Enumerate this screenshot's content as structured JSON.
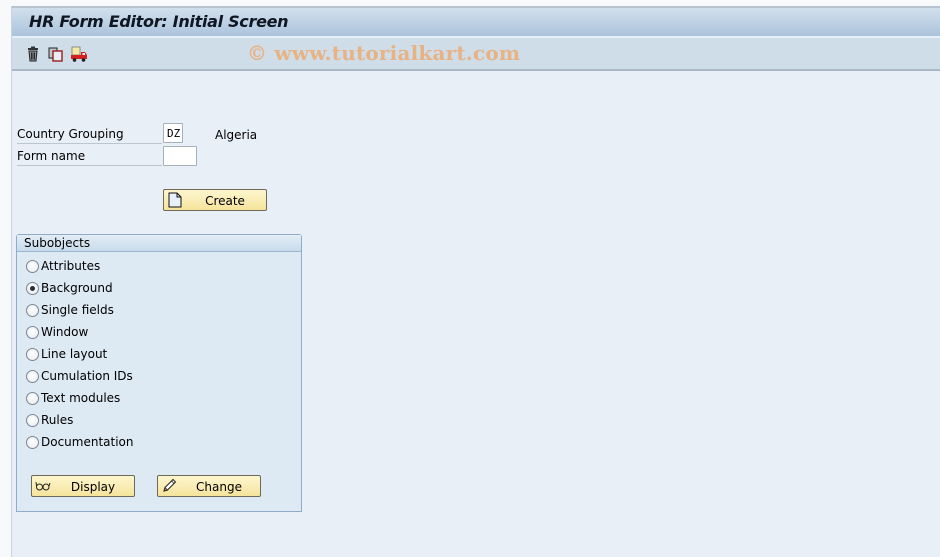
{
  "window": {
    "title": "HR Form Editor: Initial Screen",
    "watermark": "© www.tutorialkart.com"
  },
  "toolbar": {
    "items": [
      {
        "icon": "trash-icon",
        "label": "Delete"
      },
      {
        "icon": "copy-icon",
        "label": "Copy"
      },
      {
        "icon": "transport-truck-icon",
        "label": "Transport"
      }
    ]
  },
  "form": {
    "country_grouping": {
      "label": "Country Grouping",
      "value": "DZ",
      "description": "Algeria"
    },
    "form_name": {
      "label": "Form name",
      "value": ""
    },
    "create_button": {
      "label": "Create",
      "icon": "document-icon"
    }
  },
  "subobjects": {
    "title": "Subobjects",
    "selected": "Background",
    "options": [
      {
        "label": "Attributes",
        "checked": false
      },
      {
        "label": "Background",
        "checked": true
      },
      {
        "label": "Single fields",
        "checked": false
      },
      {
        "label": "Window",
        "checked": false
      },
      {
        "label": "Line layout",
        "checked": false
      },
      {
        "label": "Cumulation IDs",
        "checked": false
      },
      {
        "label": "Text modules",
        "checked": false
      },
      {
        "label": "Rules",
        "checked": false
      },
      {
        "label": "Documentation",
        "checked": false
      }
    ],
    "display_button": {
      "label": "Display",
      "icon": "glasses-icon"
    },
    "change_button": {
      "label": "Change",
      "icon": "pencil-icon"
    }
  }
}
